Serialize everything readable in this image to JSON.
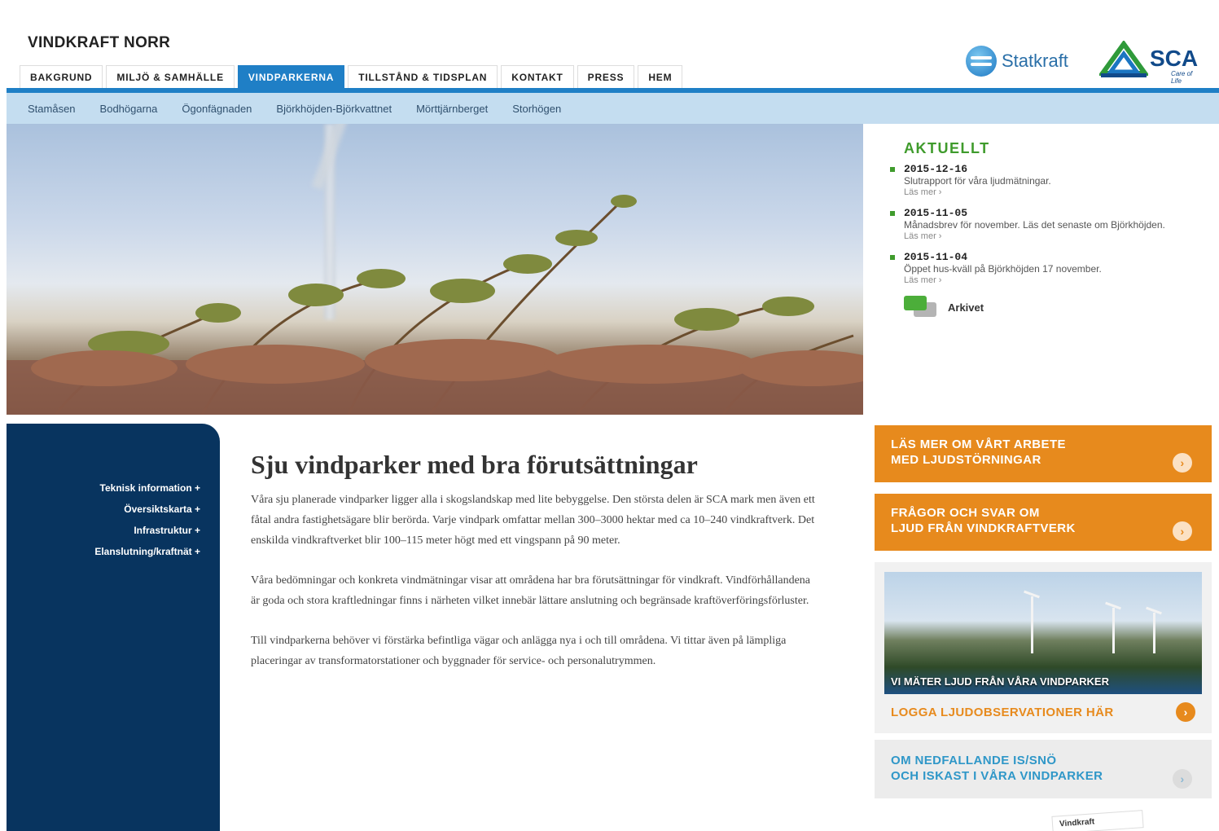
{
  "site": {
    "title": "VINDKRAFT NORR"
  },
  "main_nav": {
    "tabs": [
      {
        "label": "BAKGRUND",
        "active": false
      },
      {
        "label": "MILJÖ & SAMHÄLLE",
        "active": false
      },
      {
        "label": "VINDPARKERNA",
        "active": true
      },
      {
        "label": "TILLSTÅND & TIDSPLAN",
        "active": false
      },
      {
        "label": "KONTAKT",
        "active": false
      },
      {
        "label": "PRESS",
        "active": false
      },
      {
        "label": "HEM",
        "active": false
      }
    ]
  },
  "logos": {
    "statkraft": "Statkraft",
    "sca": "SCA",
    "sca_tagline": "Care of Life"
  },
  "sub_nav": {
    "items": [
      "Stamåsen",
      "Bodhögarna",
      "Ögonfägnaden",
      "Björkhöjden-Björkvattnet",
      "Mörttjärnberget",
      "Storhögen"
    ]
  },
  "news": {
    "heading": "AKTUELLT",
    "items": [
      {
        "date": "2015-12-16",
        "text": "Slutrapport för våra ljudmätningar.",
        "more": "Läs mer ›"
      },
      {
        "date": "2015-11-05",
        "text": "Månadsbrev för november. Läs det senaste om Björkhöjden.",
        "more": "Läs mer ›"
      },
      {
        "date": "2015-11-04",
        "text": "Öppet hus-kväll på Björkhöjden 17 november.",
        "more": "Läs mer ›"
      }
    ],
    "archive_label": "Arkivet"
  },
  "left_menu": {
    "items": [
      "Teknisk information +",
      "Översiktskarta +",
      "Infrastruktur +",
      "Elanslutning/kraftnät +"
    ]
  },
  "article": {
    "title": "Sju vindparker med bra förutsättningar",
    "paragraphs": [
      "Våra sju planerade vindparker ligger alla i skogslandskap med lite bebyggelse. Den största delen är SCA mark men även ett fåtal andra fastighetsägare blir berörda. Varje vindpark omfattar mellan 300–3000 hektar med ca 10–240 vindkraftverk. Det enskilda vindkraftverket blir 100–115 meter högt med ett vingspann på 90 meter.",
      "Våra bedömningar och konkreta vindmätningar visar att områdena har bra förutsättningar för vindkraft. Vindförhållandena är goda och stora kraftledningar finns i närheten vilket innebär lättare anslutning och begränsade kraftöverföringsförluster.",
      "Till vindparkerna behöver vi förstärka befintliga vägar och anlägga nya i och till områdena. Vi tittar även på lämpliga placeringar av transformatorstationer och byggnader för service- och personalutrymmen."
    ]
  },
  "sidebar_promos": {
    "noise_work": {
      "line1": "LÄS MER OM VÅRT ARBETE",
      "line2": "MED LJUDSTÖRNINGAR"
    },
    "faq_noise": {
      "line1": "FRÅGOR OCH SVAR OM",
      "line2": "LJUD FRÅN VINDKRAFTVERK"
    },
    "measure": {
      "caption": "VI MÄTER LJUD FRÅN VÅRA VINDPARKER",
      "link": "LOGGA LJUDOBSERVATIONER HÄR"
    },
    "ice": {
      "line1": "OM NEDFALLANDE IS/SNÖ",
      "line2": "OCH ISKAST I VÅRA VINDPARKER"
    },
    "arrow_glyph": "›"
  },
  "bottom_badge": "Vindkraft",
  "colors": {
    "nav_blue": "#1f7fc6",
    "sub_nav_bg": "#c4ddf0",
    "panel_navy": "#08345f",
    "orange": "#e78a1d",
    "green": "#3f9b2c",
    "link_blue": "#2f97c8"
  }
}
